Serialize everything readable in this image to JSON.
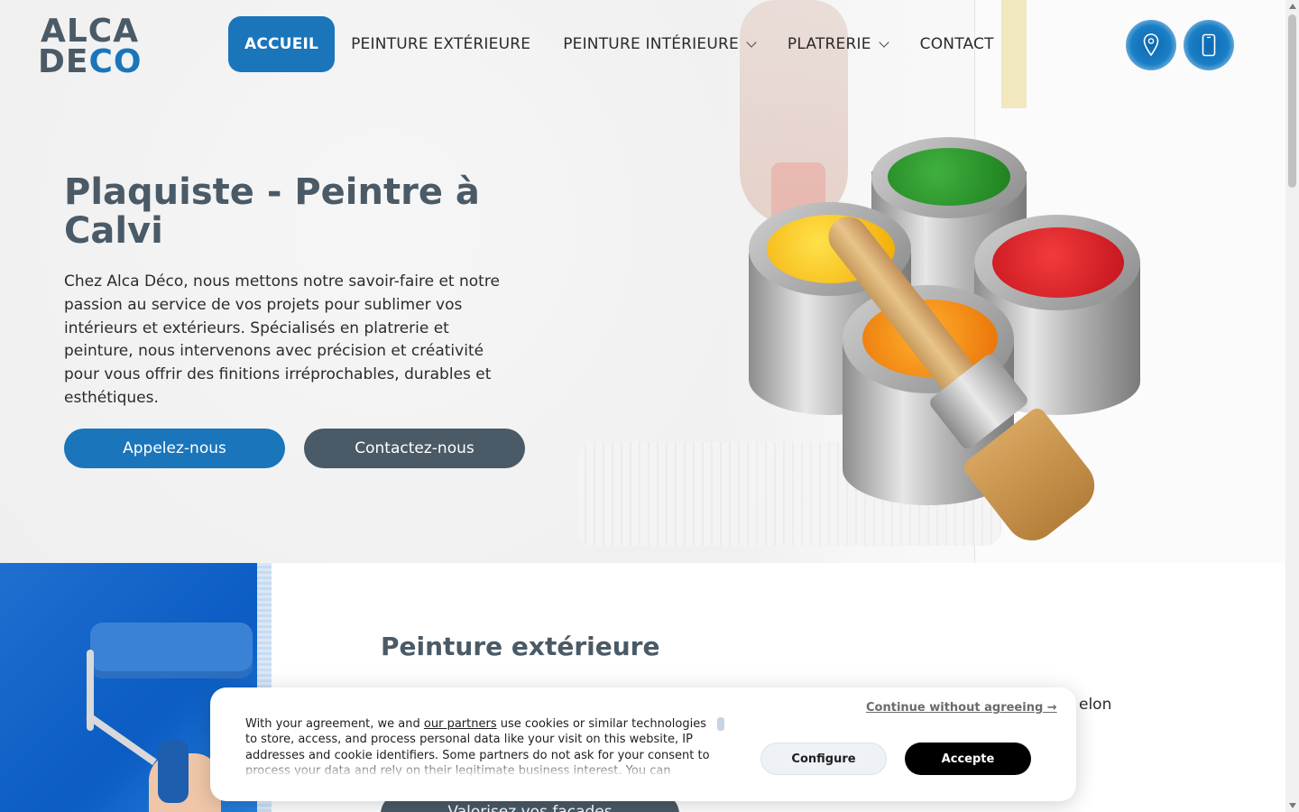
{
  "header": {
    "logo_line1": "ALCA",
    "logo_line2_a": "DE",
    "logo_line2_b": "CO",
    "nav": [
      {
        "label": "ACCUEIL"
      },
      {
        "label": "PEINTURE EXTÉRIEURE"
      },
      {
        "label": "PEINTURE INTÉRIEURE"
      },
      {
        "label": "PLATRERIE"
      },
      {
        "label": "CONTACT"
      }
    ],
    "icons": [
      "map-pin-icon",
      "phone-icon"
    ]
  },
  "hero": {
    "title": "Plaquiste - Peintre à Calvi",
    "text": "Chez Alca Déco, nous mettons notre savoir-faire et notre passion au service de vos projets pour sublimer vos intérieurs et extérieurs. Spécialisés en platrerie et peinture, nous intervenons avec précision et créativité pour vous offrir des finitions irréprochables, durables et esthétiques.",
    "btn_call": "Appelez-nous",
    "btn_contact": "Contactez-nous"
  },
  "section2": {
    "title": "Peinture extérieure",
    "partial_text": "elon",
    "cta": "Valorisez vos façades"
  },
  "cookie": {
    "text_before": "With your agreement, we and ",
    "link": "our partners",
    "text_after": " use cookies or similar technologies to store, access, and process personal data like your visit on this website, IP addresses and cookie identifiers. Some partners do not ask for your consent to process your data and rely on their legitimate business interest. You can",
    "continue": "Continue without agreeing →",
    "configure": "Configure",
    "accept": "Accepte"
  },
  "colors": {
    "accent": "#1a75bb",
    "slate": "#4a5a66"
  }
}
